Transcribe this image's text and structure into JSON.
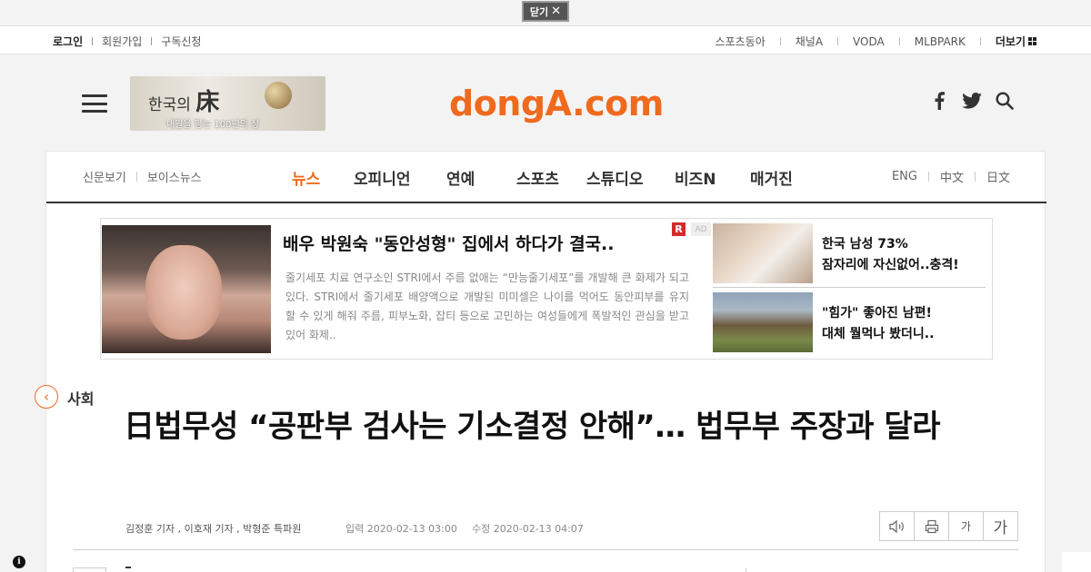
{
  "close_banner": {
    "label": "닫기",
    "icon": "✕"
  },
  "util": {
    "left": [
      "로그인",
      "회원가입",
      "구독신청"
    ],
    "right": [
      "스포츠동아",
      "채널A",
      "VODA",
      "MLBPARK"
    ],
    "more": "더보기"
  },
  "promo": {
    "title_a": "한국의 ",
    "title_b": "床",
    "subtitle": "내일을 담는 100년의 상"
  },
  "logo": "dongA.com",
  "nav": {
    "left": [
      "신문보기",
      "보이스뉴스"
    ],
    "menu": [
      "뉴스",
      "오피니언",
      "연예",
      "스포츠",
      "스튜디오",
      "비즈N",
      "매거진"
    ],
    "active": "뉴스",
    "lang": [
      "ENG",
      "中文",
      "日文"
    ]
  },
  "ad": {
    "title": "배우 박원숙 \"동안성형\" 집에서 하다가 결국..",
    "badge_r": "R",
    "badge_ad": "AD",
    "description": "줄기세포 치료 연구소인 STRI에서 주름 없애는 “만능줄기세포”를 개발해 큰 화제가 되고 있다. STRI에서 줄기세포 배양액으로 개발된 미미셀은 나이를 먹어도 동안피부를 유지 할 수 있게 해줘 주름, 피부노화, 잡티 등으로 고민하는 여성들에게 폭발적인 관심을 받고 있어 화제..",
    "side_items": [
      {
        "line1": "한국 남성 73%",
        "line2": "잠자리에 자신없어..충격!"
      },
      {
        "line1": "\"힘가\" 좋아진 남편!",
        "line2": "대체 뭘먹나 봤더니.."
      }
    ]
  },
  "article": {
    "back_icon": "‹",
    "section": "사회",
    "title": "日법무성 “공판부 검사는 기소결정 안해”… 법무부 주장과 달라",
    "byline": "김정훈 기자 , 이호재 기자 , 박형준 특파원",
    "input_time": "입력 2020-02-13 03:00",
    "edit_time": "수정 2020-02-13 04:07",
    "tools": {
      "font_small": "가",
      "font_large": "가"
    }
  },
  "info_icon": "i"
}
